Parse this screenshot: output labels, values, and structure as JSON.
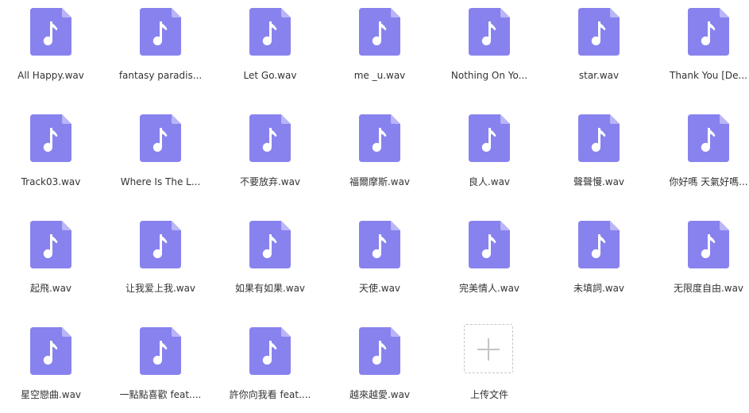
{
  "colors": {
    "file_icon_body": "#8882ee",
    "file_icon_fold": "#b9b5f7",
    "file_icon_glyph": "#ffffff",
    "label_text": "#333333",
    "upload_border": "#c6c6c6"
  },
  "icons": {
    "file": "audio-file-icon",
    "upload": "plus-icon"
  },
  "files": [
    {
      "label": "All Happy.wav"
    },
    {
      "label": "fantasy paradis..."
    },
    {
      "label": "Let Go.wav"
    },
    {
      "label": "me _u.wav"
    },
    {
      "label": "Nothing On Yo..."
    },
    {
      "label": "star.wav"
    },
    {
      "label": "Thank You [De..."
    },
    {
      "label": "Track03.wav"
    },
    {
      "label": "Where Is The L..."
    },
    {
      "label": "不要放弃.wav"
    },
    {
      "label": "福爾摩斯.wav"
    },
    {
      "label": "良人.wav"
    },
    {
      "label": "聲聲慢.wav"
    },
    {
      "label": "你好嗎 天氣好嗎..."
    },
    {
      "label": "起飛.wav"
    },
    {
      "label": "让我爱上我.wav"
    },
    {
      "label": "如果有如果.wav"
    },
    {
      "label": "天使.wav"
    },
    {
      "label": "完美情人.wav"
    },
    {
      "label": "未填詞.wav"
    },
    {
      "label": "无限度自由.wav"
    },
    {
      "label": "星空戀曲.wav"
    },
    {
      "label": "一點點喜歡 feat...."
    },
    {
      "label": "許你向我看 feat...."
    },
    {
      "label": "越來越愛.wav"
    }
  ],
  "upload": {
    "label": "上传文件"
  }
}
